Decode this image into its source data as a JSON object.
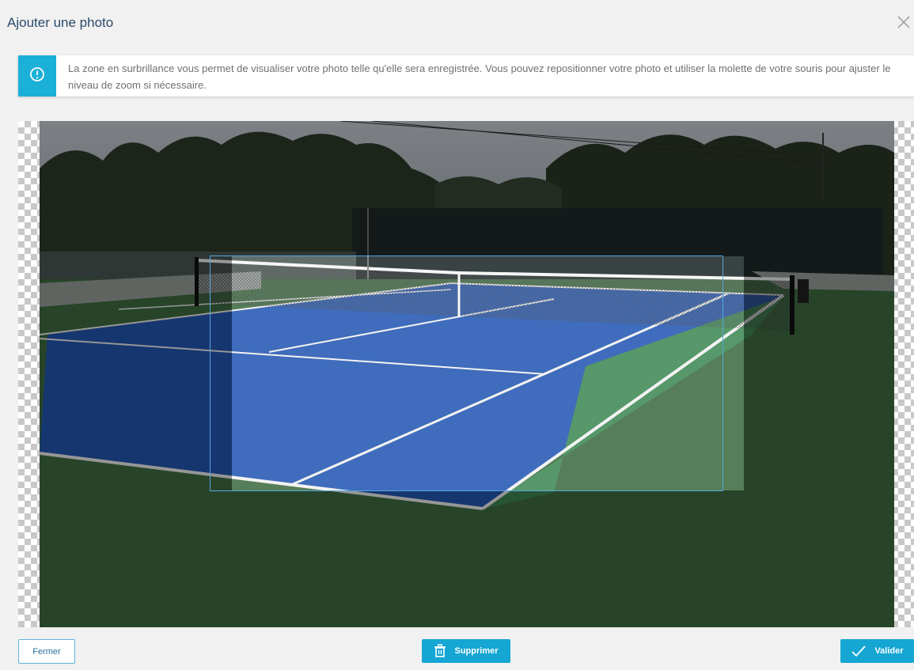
{
  "dialog": {
    "title": "Ajouter une photo",
    "close_icon": "close-icon"
  },
  "info": {
    "icon": "info-circle-icon",
    "text": "La zone en surbrillance vous permet de visualiser votre photo telle qu'elle sera enregistrée. Vous pouvez repositionner votre photo et utiliser la molette de votre souris pour ajuster le niveau de zoom si nécessaire.",
    "accent_color": "#1ab0d8"
  },
  "cropper": {
    "image_subject": "tennis court"
  },
  "footer": {
    "close_label": "Fermer",
    "delete_label": "Supprimer",
    "delete_icon": "trash-icon",
    "validate_label": "Valider",
    "validate_icon": "check-icon"
  }
}
